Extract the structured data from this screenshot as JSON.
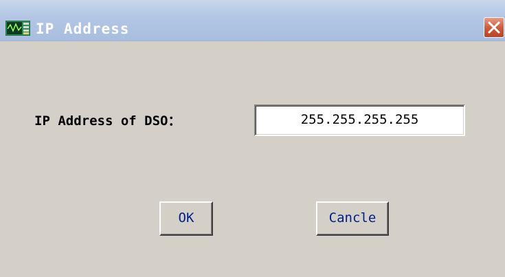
{
  "window": {
    "title": "IP Address"
  },
  "form": {
    "ip_label": "IP Address of DSO：",
    "ip_value": "255.255.255.255"
  },
  "buttons": {
    "ok_label": "OK",
    "cancel_label": "Cancle"
  },
  "icons": {
    "app": "oscilloscope-icon",
    "close": "close-icon"
  },
  "colors": {
    "dialog_background": "#d4d0c8",
    "titlebar": "#b3c6e4",
    "close_button": "#c95a3c",
    "button_text": "#00208a"
  }
}
